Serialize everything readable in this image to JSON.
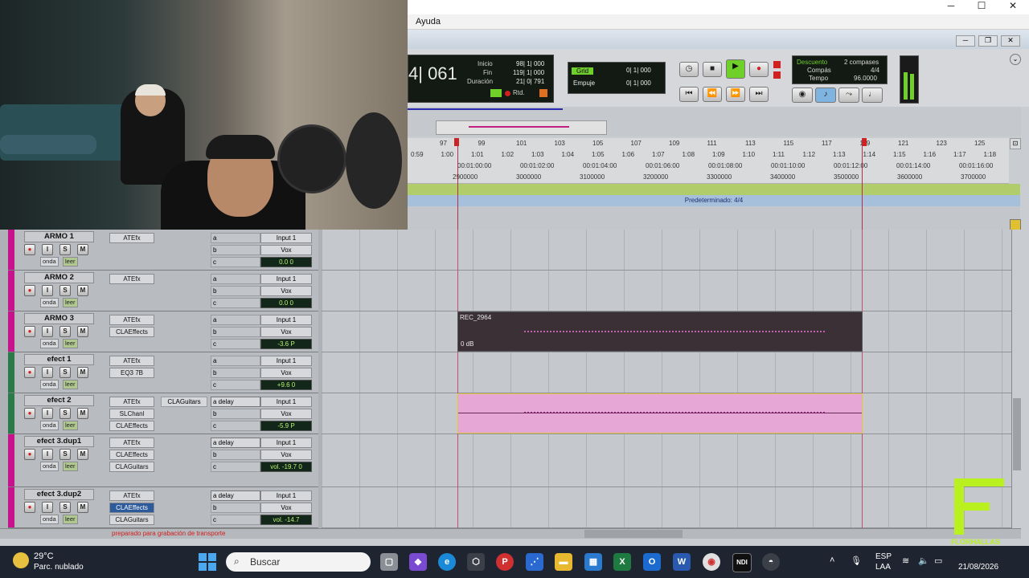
{
  "window": {
    "menu_ayuda": "Ayuda",
    "btn_minimize": "─",
    "btn_maximize": "☐",
    "btn_close": "✕"
  },
  "transport": {
    "counter_main": "4| 061",
    "inicio_label": "Inicio",
    "inicio_value": "98| 1| 000",
    "fin_label": "Fin",
    "fin_value": "119| 1| 000",
    "duracion_label": "Duración",
    "duracion_value": "21| 0| 791",
    "rtd_label": "Rtd.",
    "grid_label": "Grid",
    "grid_value": "0| 1| 000",
    "empuje_label": "Empuje",
    "empuje_value": "0| 1| 000",
    "descuento_label": "Descuento",
    "compases_value": "2 compases",
    "compas_label": "Compás",
    "compas_value": "4/4",
    "tempo_label": "Tempo",
    "tempo_value": "96.0000"
  },
  "rulers": {
    "bars": [
      "97",
      "99",
      "101",
      "103",
      "105",
      "107",
      "109",
      "111",
      "113",
      "115",
      "117",
      "119",
      "121",
      "123",
      "125"
    ],
    "mins_secs": [
      "0:59",
      "1:00",
      "1:01",
      "1:02",
      "1:03",
      "1:04",
      "1:05",
      "1:06",
      "1:07",
      "1:08",
      "1:09",
      "1:10",
      "1:11",
      "1:12",
      "1:13",
      "1:14",
      "1:15",
      "1:16",
      "1:17",
      "1:18"
    ],
    "timecode": [
      "00:01:00:00",
      "00:01:02:00",
      "00:01:04:00",
      "00:01:06:00",
      "00:01:08:00",
      "00:01:10:00",
      "00:01:12:00",
      "00:01:14:00",
      "00:01:16:00"
    ],
    "samples": [
      "2900000",
      "3000000",
      "3100000",
      "3200000",
      "3300000",
      "3400000",
      "3500000",
      "3600000",
      "3700000"
    ],
    "tempo_ruler": "Predeterminado: 4/4"
  },
  "tracks": [
    {
      "name": "ARMO 1",
      "color": "#c8148c",
      "inserts": [
        "ATEfx"
      ],
      "sends": [
        "a",
        "b",
        "c"
      ],
      "input": "Input 1",
      "output": "Vox",
      "vol": "0.0",
      "pan": "0",
      "plugin2": "",
      "send_active": ""
    },
    {
      "name": "ARMO 2",
      "color": "#c8148c",
      "inserts": [
        "ATEfx"
      ],
      "sends": [
        "a",
        "b",
        "c"
      ],
      "input": "Input 1",
      "output": "Vox",
      "vol": "0.0",
      "pan": "0",
      "plugin2": "",
      "send_active": ""
    },
    {
      "name": "ARMO 3",
      "color": "#c8148c",
      "inserts": [
        "ATEfx",
        "CLAEffects"
      ],
      "sends": [
        "a",
        "b",
        "c"
      ],
      "input": "Input 1",
      "output": "Vox",
      "vol": "-3.6",
      "pan": "P",
      "plugin2": "",
      "send_active": ""
    },
    {
      "name": "efect 1",
      "color": "#2a7a4a",
      "inserts": [
        "ATEfx",
        "EQ3 7B"
      ],
      "sends": [
        "a",
        "b",
        "c"
      ],
      "input": "Input 1",
      "output": "Vox",
      "vol": "+9.6",
      "pan": "0",
      "plugin2": "",
      "send_active": ""
    },
    {
      "name": "efect 2",
      "color": "#2a7a4a",
      "inserts": [
        "ATEfx",
        "SLChanl",
        "CLAEffects"
      ],
      "sends": [
        "a",
        "b",
        "c"
      ],
      "input": "Input 1",
      "output": "Vox",
      "vol": "-5.9",
      "pan": "P",
      "plugin2": "CLAGuitars",
      "send_active": "delay"
    },
    {
      "name": "efect 3.dup1",
      "color": "#c8148c",
      "inserts": [
        "ATEfx",
        "CLAEffects",
        "CLAGuitars"
      ],
      "sends": [
        "a",
        "b",
        "c"
      ],
      "input": "Input 1",
      "output": "Vox",
      "vol": "-19.7",
      "pan": "0",
      "plugin2": "",
      "send_active": "delay"
    },
    {
      "name": "efect 3.dup2",
      "color": "#c8148c",
      "inserts": [
        "ATEfx",
        "CLAEffects",
        "CLAGuitars"
      ],
      "sends": [
        "a",
        "b",
        "c"
      ],
      "input": "Input 1",
      "output": "Vox",
      "vol": "-14.7",
      "pan": "",
      "plugin2": "",
      "send_active": "delay"
    }
  ],
  "track_buttons": {
    "rec": "●",
    "input": "I",
    "solo": "S",
    "mute": "M",
    "onda": "onda",
    "lee": "leer"
  },
  "clips": {
    "clip1_name": "REC_2964",
    "clip1_gain": "0 dB"
  },
  "status": {
    "message": "preparado para grabación de transporte"
  },
  "taskbar": {
    "weather_temp": "29°C",
    "weather_desc": "Parc. nublado",
    "search_placeholder": "Buscar",
    "lang_line1": "ESP",
    "lang_line2": "LAA",
    "time": "21/08/2026",
    "watermark": "FLORHALLAS"
  }
}
